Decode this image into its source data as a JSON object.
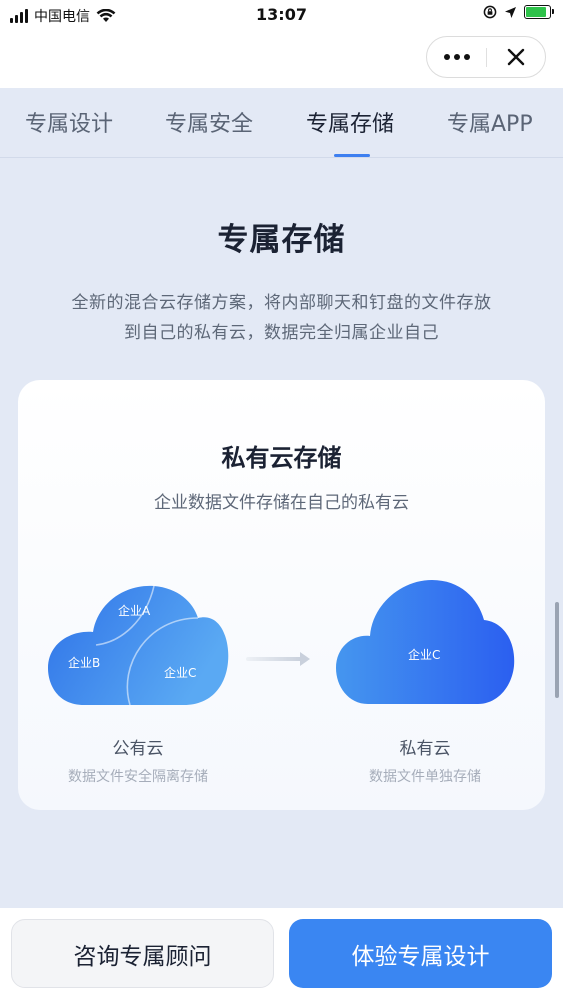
{
  "status_bar": {
    "carrier": "中国电信",
    "time": "13:07"
  },
  "tabs": [
    {
      "label": "专属设计"
    },
    {
      "label": "专属安全"
    },
    {
      "label": "专属存储"
    },
    {
      "label": "专属APP"
    }
  ],
  "active_tab_index": 2,
  "section": {
    "title": "专属存储",
    "description_line1": "全新的混合云存储方案，将内部聊天和钉盘的文件存放",
    "description_line2": "到自己的私有云，数据完全归属企业自己"
  },
  "card": {
    "title": "私有云存储",
    "subtitle": "企业数据文件存储在自己的私有云",
    "public_cloud": {
      "label_a": "企业A",
      "label_b": "企业B",
      "label_c": "企业C",
      "caption": "公有云",
      "caption_sub": "数据文件安全隔离存储"
    },
    "private_cloud": {
      "label": "企业C",
      "caption": "私有云",
      "caption_sub": "数据文件单独存储"
    }
  },
  "buttons": {
    "consult": "咨询专属顾问",
    "try": "体验专属设计"
  },
  "colors": {
    "accent": "#3a86f2",
    "tab_underline": "#3d7ff0",
    "background": "#e3e9f5"
  },
  "icons": {
    "more": "more-dots-icon",
    "close": "close-icon",
    "arrow": "arrow-right-icon"
  }
}
